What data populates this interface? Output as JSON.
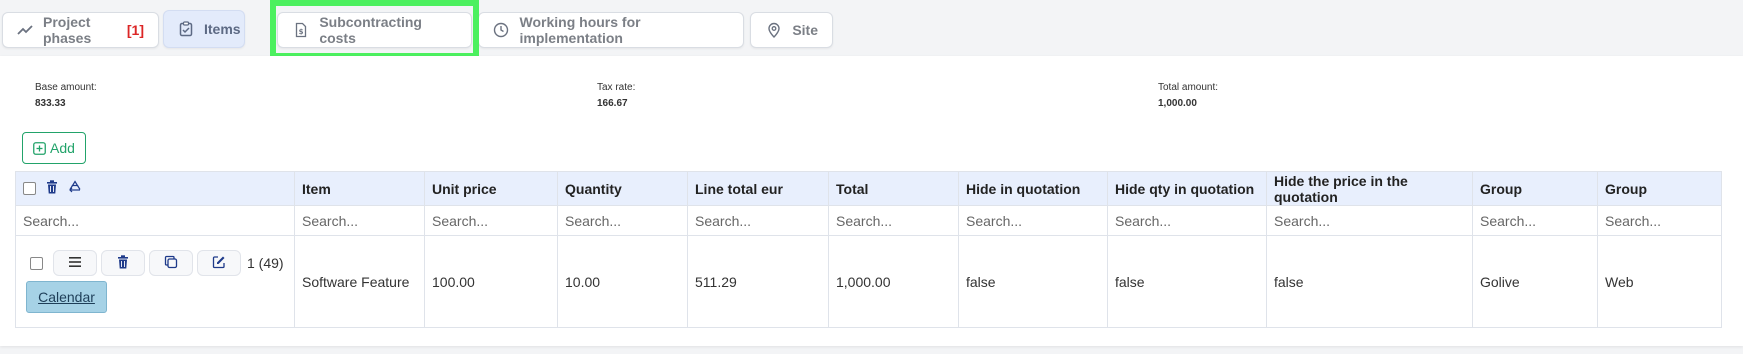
{
  "tabs": [
    {
      "label": "Project phases",
      "count": "[1]",
      "icon": "trend-line-icon"
    },
    {
      "label": "Items",
      "icon": "clipboard-check-icon"
    },
    {
      "label": "Subcontracting costs",
      "icon": "document-dollar-icon"
    },
    {
      "label": "Working hours for implementation",
      "icon": "clock-icon"
    },
    {
      "label": "Site",
      "icon": "map-pin-icon"
    }
  ],
  "summary": {
    "base_amount_label": "Base amount:",
    "base_amount_value": "833.33",
    "tax_rate_label": "Tax rate:",
    "tax_rate_value": "166.67",
    "total_amount_label": "Total amount:",
    "total_amount_value": "1,000.00"
  },
  "toolbar": {
    "add_label": "Add"
  },
  "table": {
    "columns": [
      "Item",
      "Unit price",
      "Quantity",
      "Line total eur",
      "Total",
      "Hide in quotation",
      "Hide qty in quotation",
      "Hide the price in the quotation",
      "Group",
      "Group"
    ],
    "search_placeholder": "Search...",
    "row": {
      "count_label": "1 (49)",
      "calendar_label": "Calendar",
      "cells": [
        "Software Feature",
        "100.00",
        "10.00",
        "511.29",
        "1,000.00",
        "false",
        "false",
        "false",
        "Golive",
        "Web"
      ]
    }
  },
  "colors": {
    "accent_green": "#22a36a",
    "highlight": "#4cf05f",
    "active_tab": "#e3ebfb",
    "header_bg": "#e8effd",
    "error_red": "#dc2626",
    "icon_blue": "#1e3a8a"
  }
}
